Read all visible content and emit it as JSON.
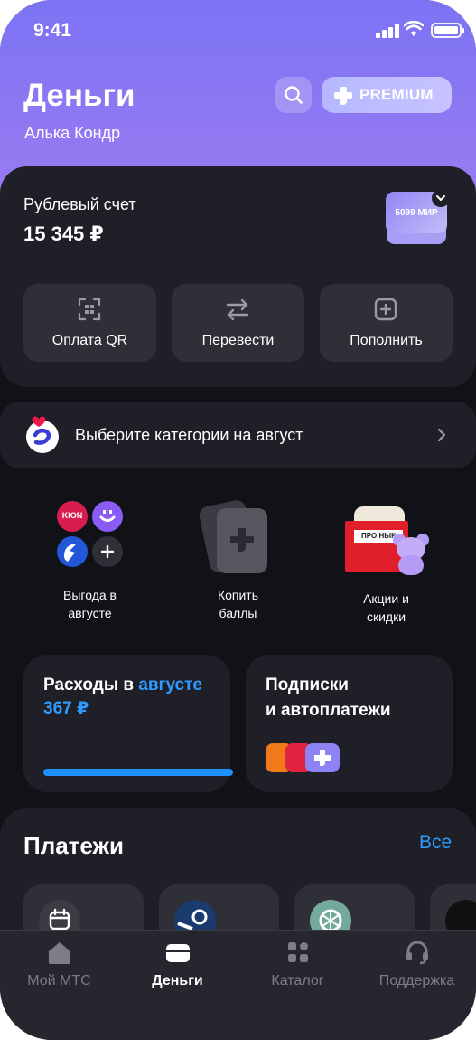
{
  "status_bar": {
    "time": "9:41"
  },
  "header": {
    "title": "Деньги",
    "user_name": "Алька Кондр",
    "premium_label": "PREMIUM"
  },
  "account": {
    "label": "Рублевый счет",
    "balance": "15 345 ₽",
    "card_label": "5099 МИР",
    "actions": [
      {
        "label": "Оплата QR",
        "icon": "qr-scan-icon"
      },
      {
        "label": "Перевести",
        "icon": "transfer-arrows-icon"
      },
      {
        "label": "Пополнить",
        "icon": "plus-square-icon"
      }
    ]
  },
  "category_banner": {
    "text": "Выберите категории на август"
  },
  "promos": [
    {
      "line1": "Выгода в",
      "line2": "августе"
    },
    {
      "line1": "Копить",
      "line2": "баллы"
    },
    {
      "line1": "Акции и",
      "line2": "скидки"
    }
  ],
  "promo_art": {
    "brand_logo": "KION",
    "bag_label": "ПРО НЫК"
  },
  "expenses": {
    "title_prefix": "Расходы в",
    "title_month": "августе",
    "amount": "367 ₽",
    "progress": 1.0
  },
  "subscriptions": {
    "line1": "Подписки",
    "line2": "и автоплатежи"
  },
  "payments": {
    "title": "Платежи",
    "all_label": "Все",
    "tiles": [
      {
        "icon": "calendar-icon"
      },
      {
        "icon": "steam-icon"
      },
      {
        "icon": "openai-icon"
      },
      {
        "icon": "pubg-mobile-icon"
      }
    ]
  },
  "tabbar": {
    "items": [
      {
        "label": "Мой МТС",
        "icon": "home-icon"
      },
      {
        "label": "Деньги",
        "icon": "wallet-icon"
      },
      {
        "label": "Каталог",
        "icon": "catalog-icon"
      },
      {
        "label": "Поддержка",
        "icon": "headset-icon"
      }
    ]
  },
  "colors": {
    "header_gradient_start": "#7b73f4",
    "header_gradient_end": "#9d7cf0",
    "accent_blue": "#2e9bff",
    "card_bg": "#1f2027",
    "app_bg": "#111118"
  }
}
